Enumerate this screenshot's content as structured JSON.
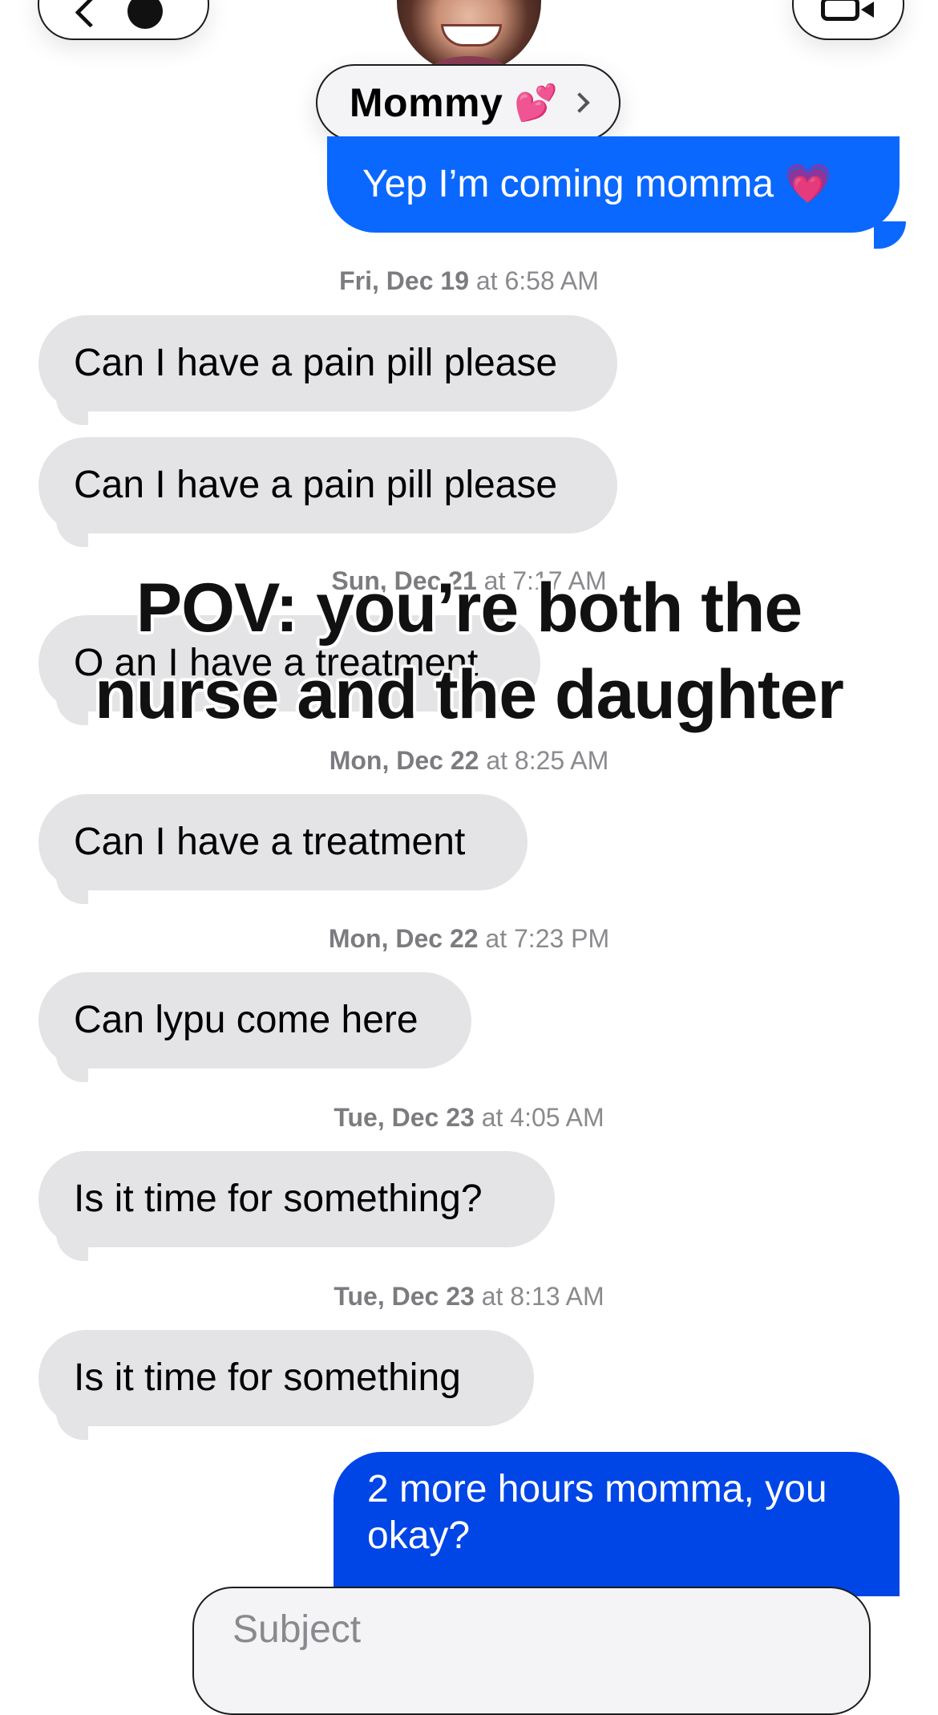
{
  "header": {
    "contact_name": "Mommy",
    "contact_emoji": "💕",
    "back_icon": "chevron-left-icon",
    "video_icon": "video-camera-icon"
  },
  "messages": [
    {
      "type": "outgoing",
      "text": "Yep I’m coming momma 💗"
    },
    {
      "type": "timestamp",
      "day": "Fri, Dec 19",
      "time": "at 6:58 AM"
    },
    {
      "type": "incoming",
      "text": "Can I have a pain pill please"
    },
    {
      "type": "incoming",
      "text": "Can I have a pain pill please"
    },
    {
      "type": "timestamp",
      "day": "Sun, Dec 21",
      "time": "at 7:17 AM"
    },
    {
      "type": "incoming",
      "text": "O an I have a treatment"
    },
    {
      "type": "timestamp",
      "day": "Mon, Dec 22",
      "time": "at 8:25 AM"
    },
    {
      "type": "incoming",
      "text": "Can I have a treatment"
    },
    {
      "type": "timestamp",
      "day": "Mon, Dec 22",
      "time": "at 7:23 PM"
    },
    {
      "type": "incoming",
      "text": "Can lypu come here"
    },
    {
      "type": "timestamp",
      "day": "Tue, Dec 23",
      "time": "at 4:05 AM"
    },
    {
      "type": "incoming",
      "text": "Is it time for something?"
    },
    {
      "type": "timestamp",
      "day": "Tue, Dec 23",
      "time": "at 8:13 AM"
    },
    {
      "type": "incoming",
      "text": "Is it time for something"
    },
    {
      "type": "outgoing",
      "text": "2 more hours momma, you okay?"
    }
  ],
  "overlay": {
    "line1": "POV: you’re both the",
    "line2": "nurse and the daughter"
  },
  "compose": {
    "subject_placeholder": "Subject"
  },
  "colors": {
    "outgoing_bubble": "#0a68ff",
    "incoming_bubble": "#e4e4e7",
    "timestamp_text": "#8a8a8e"
  }
}
